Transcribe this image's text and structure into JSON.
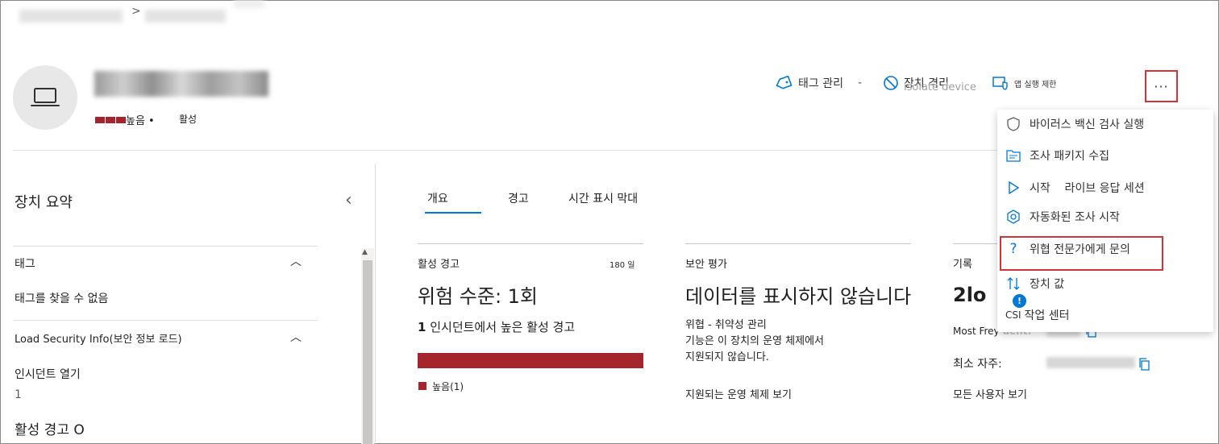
{
  "breadcrumb": {
    "separator": ">"
  },
  "device": {
    "risk_level": "높음 •",
    "status": "활성"
  },
  "actions": {
    "manage_tags": "태그 관리",
    "isolate": "장치 격리",
    "isolate_ghost": "isolate device",
    "restrict_app": "앱 실행 제한",
    "more": "···"
  },
  "menu": {
    "items": [
      {
        "label": "바이러스 백신 검사 실행",
        "icon": "shield-icon"
      },
      {
        "label": "조사 패키지 수집",
        "icon": "folder-icon"
      },
      {
        "label": "시작    라이브 응답 세션",
        "icon": "play-icon"
      },
      {
        "label": "자동화된 조사 시작",
        "icon": "gear-hex-icon"
      },
      {
        "label": "위협 전문가에게 문의",
        "icon": "question-icon"
      },
      {
        "label": "장치 값",
        "icon": "sort-arrows-icon"
      },
      {
        "label": "작업 센터",
        "icon": "csi-icon"
      }
    ],
    "csi_prefix": "CSI",
    "info_badge": "!"
  },
  "summary": {
    "title": "장치 요약",
    "tags_section": "태그",
    "no_tags": "태그를 찾을 수 없음",
    "load_security": "Load Security Info(보안 정보 로드)",
    "open_incidents_label": "인시던트 열기",
    "open_incidents_value": "1",
    "active_alerts_label": "활성 경고 O"
  },
  "tabs": [
    "개요",
    "경고",
    "시간 표시 막대"
  ],
  "cards": {
    "active_alerts": {
      "title": "활성 경고",
      "days": "180 일",
      "risk_level": "위험 수준: 1회",
      "incident_count": "1",
      "incident_text": "인시던트에서 높은  활성 경고",
      "legend": "높음(1)"
    },
    "security_assessment": {
      "title": "보안 평가",
      "no_data": "데이터를 표시하지 않습니다",
      "threat_line1": "위협 - 취약성 관리",
      "threat_line2": "기능은 이 장치의 운영 체제에서",
      "threat_line3": "지원되지 않습니다.",
      "supported_os": "지원되는 운영 체제 보기"
    },
    "logged_on": {
      "title": "기록",
      "log_big": "2lo",
      "most_freq": "Most Frey",
      "most_freq_suffix": "uent:",
      "least_freq": "최소 자주:",
      "all_users": "모든 사용자 보기"
    }
  },
  "colors": {
    "accent": "#0078d4",
    "high_risk": "#a4262c",
    "highlight": "#d13438"
  }
}
